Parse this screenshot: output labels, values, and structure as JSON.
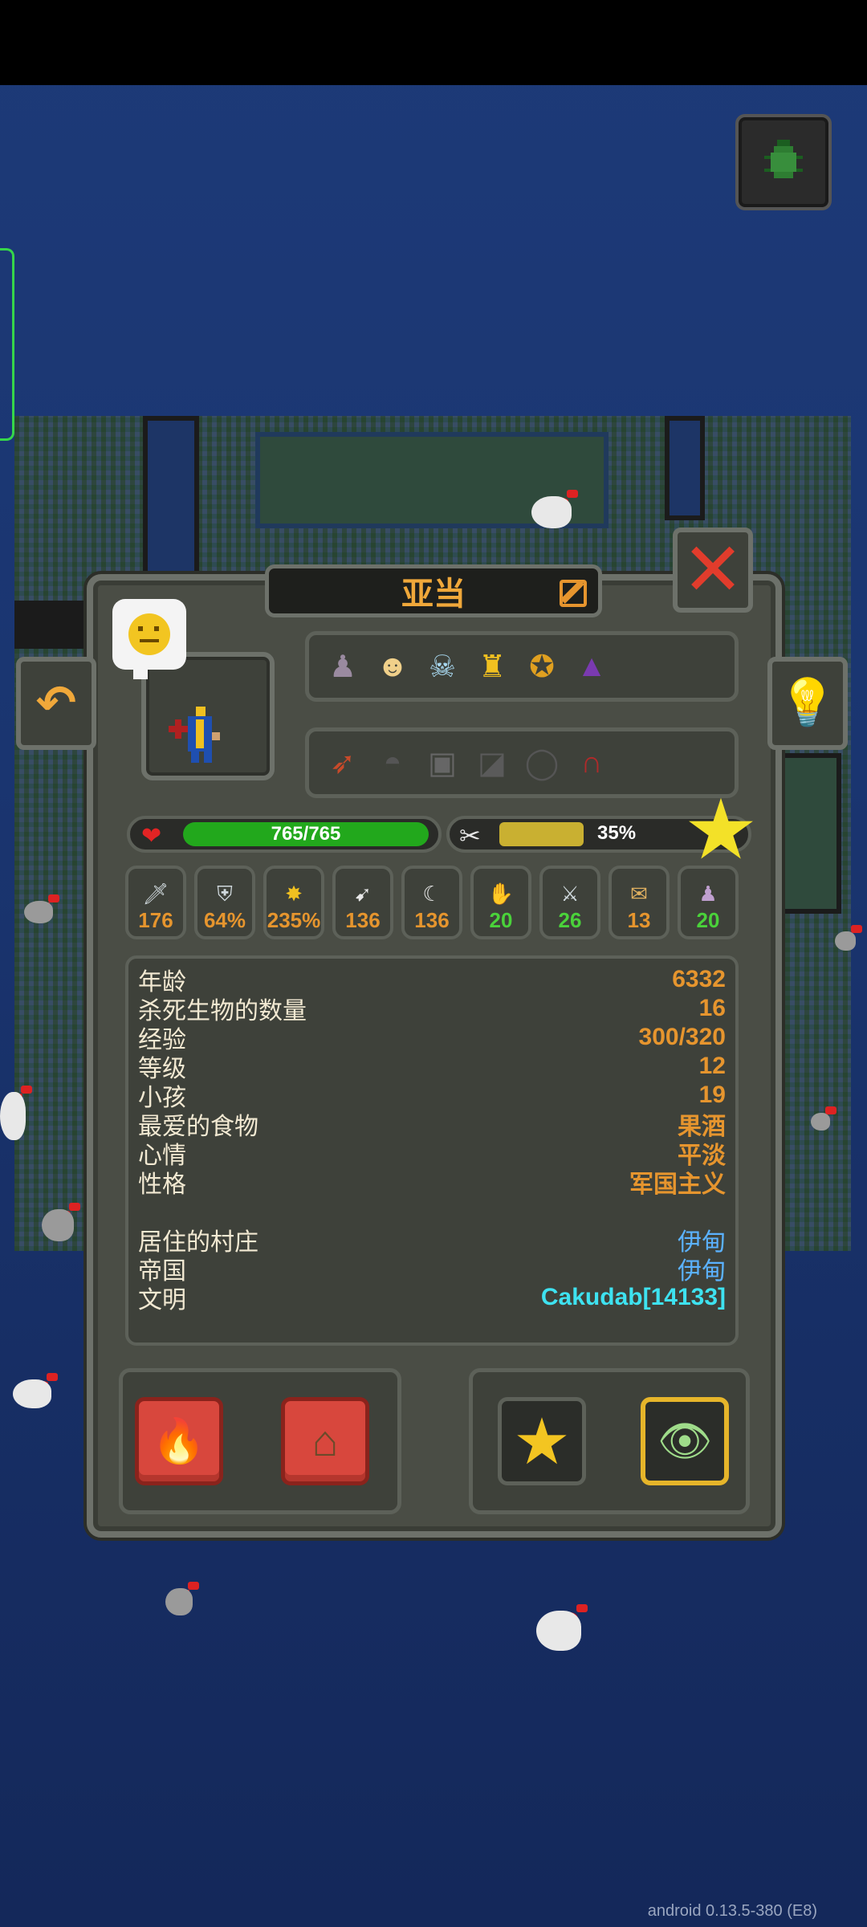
{
  "character": {
    "name": "亚当"
  },
  "health": {
    "text": "765/765",
    "fraction": 1.0
  },
  "hunger": {
    "text": "35%",
    "fraction": 0.35
  },
  "traits_icons": [
    "statue-icon",
    "blonde-face-icon",
    "skull-icon",
    "golden-tooth-icon",
    "medal-icon",
    "wizard-hat-icon"
  ],
  "equipment_icons": [
    "bow-icon",
    "helmet-icon",
    "armor-icon",
    "boots-icon",
    "ring-icon",
    "amulet-icon"
  ],
  "stats": [
    {
      "icon": "sword-icon",
      "value": "176",
      "color": "orange"
    },
    {
      "icon": "shield-icon",
      "value": "64%",
      "color": "orange"
    },
    {
      "icon": "crit-icon",
      "value": "235%",
      "color": "orange"
    },
    {
      "icon": "speed-icon",
      "value": "136",
      "color": "orange"
    },
    {
      "icon": "scythe-icon",
      "value": "136",
      "color": "orange"
    },
    {
      "icon": "diplomacy-icon",
      "value": "20",
      "color": "green"
    },
    {
      "icon": "warfare-icon",
      "value": "26",
      "color": "green"
    },
    {
      "icon": "stewardship-icon",
      "value": "13",
      "color": "orange"
    },
    {
      "icon": "intelligence-icon",
      "value": "20",
      "color": "green"
    }
  ],
  "info": {
    "age_label": "年龄",
    "age_value": "6332",
    "kills_label": "杀死生物的数量",
    "kills_value": "16",
    "exp_label": "经验",
    "exp_value": "300/320",
    "level_label": "等级",
    "level_value": "12",
    "children_label": "小孩",
    "children_value": "19",
    "food_label": "最爱的食物",
    "food_value": "果酒",
    "mood_label": "心情",
    "mood_value": "平淡",
    "personality_label": "性格",
    "personality_value": "军国主义",
    "village_label": "居住的村庄",
    "village_value": "伊甸",
    "kingdom_label": "帝国",
    "kingdom_value": "伊甸",
    "culture_label": "文明",
    "culture_value": "Cakudab[14133]"
  },
  "colors": {
    "accent_orange": "#e6952e",
    "link_blue": "#5bb2ff",
    "culture_cyan": "#3ee2f0",
    "health_green": "#22a81c",
    "hunger_yellow": "#c9b031",
    "close_red": "#e23c2c"
  },
  "buttons": {
    "close_glyph": "✕",
    "back_glyph": "↶",
    "bulb_glyph": "💡",
    "heart_glyph": "❤",
    "cutlery_glyph": "✂",
    "star_glyph": "★"
  },
  "version_text": "android 0.13.5-380 (E8)"
}
